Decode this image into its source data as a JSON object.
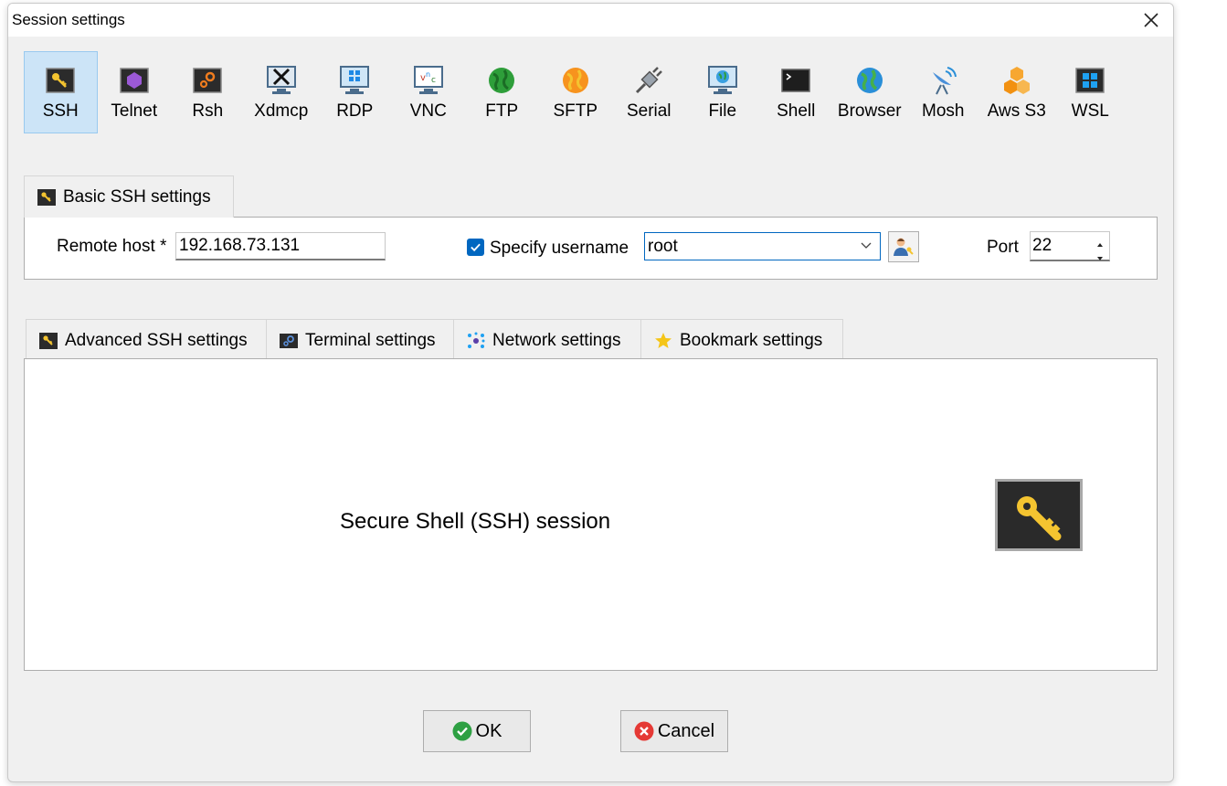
{
  "window": {
    "title": "Session settings"
  },
  "session_types": [
    {
      "label": "SSH",
      "icon": "key-icon",
      "active": true
    },
    {
      "label": "Telnet",
      "icon": "telnet-icon"
    },
    {
      "label": "Rsh",
      "icon": "rsh-icon"
    },
    {
      "label": "Xdmcp",
      "icon": "xdmcp-icon"
    },
    {
      "label": "RDP",
      "icon": "rdp-icon"
    },
    {
      "label": "VNC",
      "icon": "vnc-icon"
    },
    {
      "label": "FTP",
      "icon": "ftp-globe-icon"
    },
    {
      "label": "SFTP",
      "icon": "sftp-globe-icon"
    },
    {
      "label": "Serial",
      "icon": "serial-plug-icon"
    },
    {
      "label": "File",
      "icon": "file-monitor-icon"
    },
    {
      "label": "Shell",
      "icon": "shell-terminal-icon"
    },
    {
      "label": "Browser",
      "icon": "browser-globe-icon"
    },
    {
      "label": "Mosh",
      "icon": "mosh-antenna-icon"
    },
    {
      "label": "Aws S3",
      "icon": "aws-s3-icon"
    },
    {
      "label": "WSL",
      "icon": "wsl-windows-icon"
    }
  ],
  "basic": {
    "tab_label": "Basic SSH settings",
    "remote_host_label": "Remote host *",
    "remote_host_value": "192.168.73.131",
    "specify_username_label": "Specify username",
    "specify_username_checked": true,
    "username_value": "root",
    "port_label": "Port",
    "port_value": "22"
  },
  "advanced_tabs": [
    {
      "label": "Advanced SSH settings",
      "icon": "key-icon"
    },
    {
      "label": "Terminal settings",
      "icon": "terminal-gear-icon"
    },
    {
      "label": "Network settings",
      "icon": "network-nodes-icon"
    },
    {
      "label": "Bookmark settings",
      "icon": "star-icon"
    }
  ],
  "description": "Secure Shell (SSH) session",
  "buttons": {
    "ok": "OK",
    "cancel": "Cancel"
  },
  "colors": {
    "accent": "#0067c0",
    "active_tab": "#cce4f7",
    "key_yellow": "#f4c430",
    "ok_green": "#2ea043",
    "cancel_red": "#e53935"
  }
}
